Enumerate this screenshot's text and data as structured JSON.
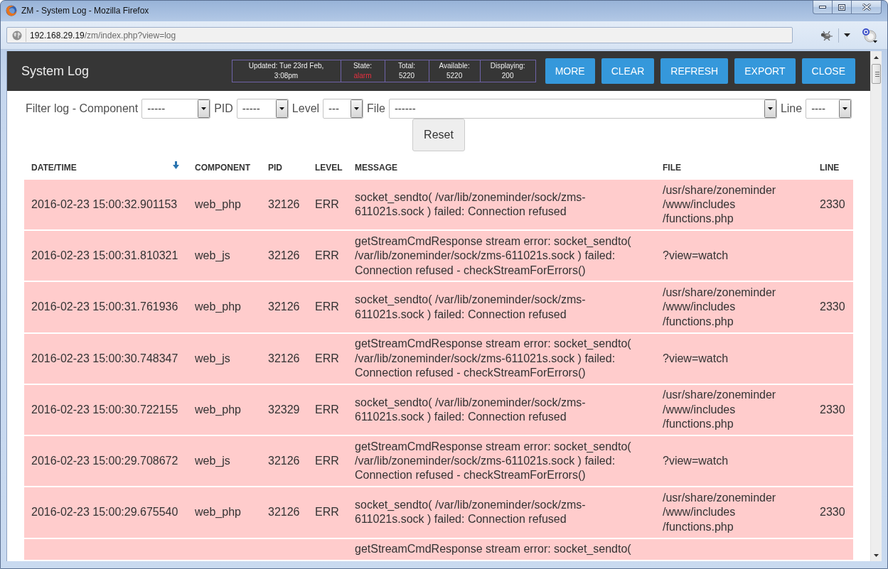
{
  "window": {
    "title": "ZM - System Log - Mozilla Firefox"
  },
  "address_bar": {
    "host": "192.168.29.19",
    "path": "/zm/index.php?view=log"
  },
  "header": {
    "title": "System Log",
    "summary": [
      {
        "kind": "timestamp",
        "label": "Updated:",
        "value": "Tue 23rd Feb, 3:08pm",
        "alert": false
      },
      {
        "kind": "reading",
        "label": "State:",
        "value": "alarm",
        "alert": true
      },
      {
        "kind": "reading",
        "label": "Total:",
        "value": "5220",
        "alert": false
      },
      {
        "kind": "reading",
        "label": "Available:",
        "value": "5220",
        "alert": false
      },
      {
        "kind": "reading",
        "label": "Displaying:",
        "value": "200",
        "alert": false
      }
    ],
    "buttons": [
      "MORE",
      "CLEAR",
      "REFRESH",
      "EXPORT",
      "CLOSE"
    ]
  },
  "filters": {
    "fields": [
      {
        "label": "Filter log - Component",
        "value": "-----"
      },
      {
        "label": "PID",
        "value": "-----"
      },
      {
        "label": "Level",
        "value": "---"
      },
      {
        "label": "File",
        "value": "------"
      },
      {
        "label": "Line",
        "value": "----"
      }
    ],
    "reset_button": "Reset"
  },
  "table": {
    "columns": [
      {
        "label": "DATE/TIME",
        "sorted": true
      },
      {
        "label": "COMPONENT",
        "sorted": false
      },
      {
        "label": "PID",
        "sorted": false
      },
      {
        "label": "LEVEL",
        "sorted": false
      },
      {
        "label": "MESSAGE",
        "sorted": false
      },
      {
        "label": "FILE",
        "sorted": false
      },
      {
        "label": "LINE",
        "sorted": false
      }
    ],
    "rows": [
      {
        "date_time": "2016-02-23 15:00:32.901153",
        "component": "web_php",
        "pid": "32126",
        "log_level": "ERR",
        "message": "socket_sendto( /var/lib/zoneminder/sock/zms-611021s.sock ) failed: Connection refused",
        "file": "/usr/share/zoneminder/www/includes/functions.php",
        "line": "2330"
      },
      {
        "date_time": "2016-02-23 15:00:31.810321",
        "component": "web_js",
        "pid": "32126",
        "log_level": "ERR",
        "message": "getStreamCmdResponse stream error: socket_sendto( /var/lib/zoneminder/sock/zms-611021s.sock ) failed: Connection refused - checkStreamForErrors()",
        "file": "?view=watch"
      },
      {
        "date_time": "2016-02-23 15:00:31.761936",
        "component": "web_php",
        "pid": "32126",
        "log_level": "ERR",
        "message": "socket_sendto( /var/lib/zoneminder/sock/zms-611021s.sock ) failed: Connection refused",
        "file": "/usr/share/zoneminder/www/includes/functions.php",
        "line": "2330"
      },
      {
        "date_time": "2016-02-23 15:00:30.748347",
        "component": "web_js",
        "pid": "32126",
        "log_level": "ERR",
        "message": "getStreamCmdResponse stream error: socket_sendto( /var/lib/zoneminder/sock/zms-611021s.sock ) failed: Connection refused - checkStreamForErrors()",
        "file": "?view=watch"
      },
      {
        "date_time": "2016-02-23 15:00:30.722155",
        "component": "web_php",
        "pid": "32329",
        "log_level": "ERR",
        "message": "socket_sendto( /var/lib/zoneminder/sock/zms-611021s.sock ) failed: Connection refused",
        "file": "/usr/share/zoneminder/www/includes/functions.php",
        "line": "2330"
      },
      {
        "date_time": "2016-02-23 15:00:29.708672",
        "component": "web_js",
        "pid": "32126",
        "log_level": "ERR",
        "message": "getStreamCmdResponse stream error: socket_sendto( /var/lib/zoneminder/sock/zms-611021s.sock ) failed: Connection refused - checkStreamForErrors()",
        "file": "?view=watch"
      },
      {
        "date_time": "2016-02-23 15:00:29.675540",
        "component": "web_php",
        "pid": "32126",
        "log_level": "ERR",
        "message": "socket_sendto( /var/lib/zoneminder/sock/zms-611021s.sock ) failed: Connection refused",
        "file": "/usr/share/zoneminder/www/includes/functions.php",
        "line": "2330"
      },
      {
        "message": "getStreamCmdResponse stream error: socket_sendto("
      }
    ]
  }
}
